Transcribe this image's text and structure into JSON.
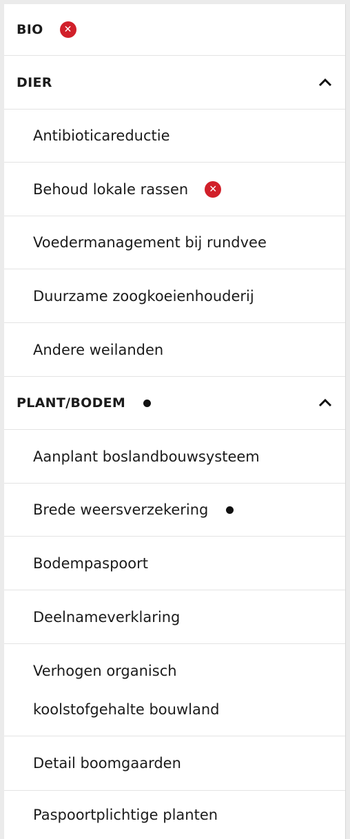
{
  "menu": {
    "sections": [
      {
        "label": "BIO",
        "status": "error-icon"
      },
      {
        "label": "DIER",
        "expanded": true,
        "toggle_icon": "chevron-up-icon"
      },
      {
        "label": "PLANT/BODEM",
        "status": "dot-icon",
        "expanded": true,
        "toggle_icon": "chevron-up-icon"
      }
    ],
    "dier_items": [
      {
        "label": "Antibioticareductie"
      },
      {
        "label": "Behoud lokale rassen",
        "status": "error-icon"
      },
      {
        "label": "Voedermanagement bij rundvee"
      },
      {
        "label": "Duurzame zoogkoeienhouderij"
      },
      {
        "label": "Andere weilanden"
      }
    ],
    "plant_items": [
      {
        "label": "Aanplant boslandbouwsysteem"
      },
      {
        "label": "Brede weersverzekering",
        "status": "dot-icon"
      },
      {
        "label": "Bodempaspoort"
      },
      {
        "label": "Deelnameverklaring"
      },
      {
        "label_line1": "Verhogen organisch",
        "label_line2": "koolstofgehalte bouwland"
      },
      {
        "label": "Detail boomgaarden"
      },
      {
        "label": "Paspoortplichtige planten"
      }
    ]
  },
  "colors": {
    "error": "#d1202a",
    "text": "#1b1b1b",
    "divider": "#e3e3e3",
    "background": "#ebebeb"
  }
}
